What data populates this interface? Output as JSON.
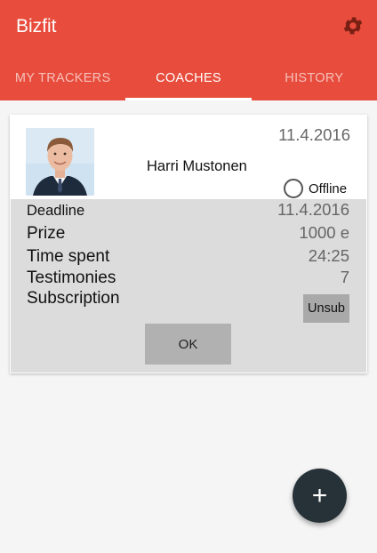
{
  "app": {
    "title": "Bizfit"
  },
  "colors": {
    "primary": "#e74c3c",
    "fab": "#263238",
    "dialog": "#dcdcdc"
  },
  "tabs": [
    {
      "label": "MY TRACKERS",
      "active": false
    },
    {
      "label": "COACHES",
      "active": true
    },
    {
      "label": "HISTORY",
      "active": false
    }
  ],
  "card": {
    "date": "11.4.2016",
    "coach_name": "Harri Mustonen",
    "status": "Offline"
  },
  "details": {
    "deadline_label": "Deadline",
    "deadline_value": "11.4.2016",
    "prize_label": "Prize",
    "prize_value": "1000 e",
    "time_spent_label": "Time spent",
    "time_spent_value": "24:25",
    "testimonies_label": "Testimonies",
    "testimonies_value": "7",
    "subscription_label": "Subscription",
    "unsub_label": "Unsub",
    "ok_label": "OK"
  },
  "fab": {
    "icon": "plus-icon",
    "label": "+"
  }
}
